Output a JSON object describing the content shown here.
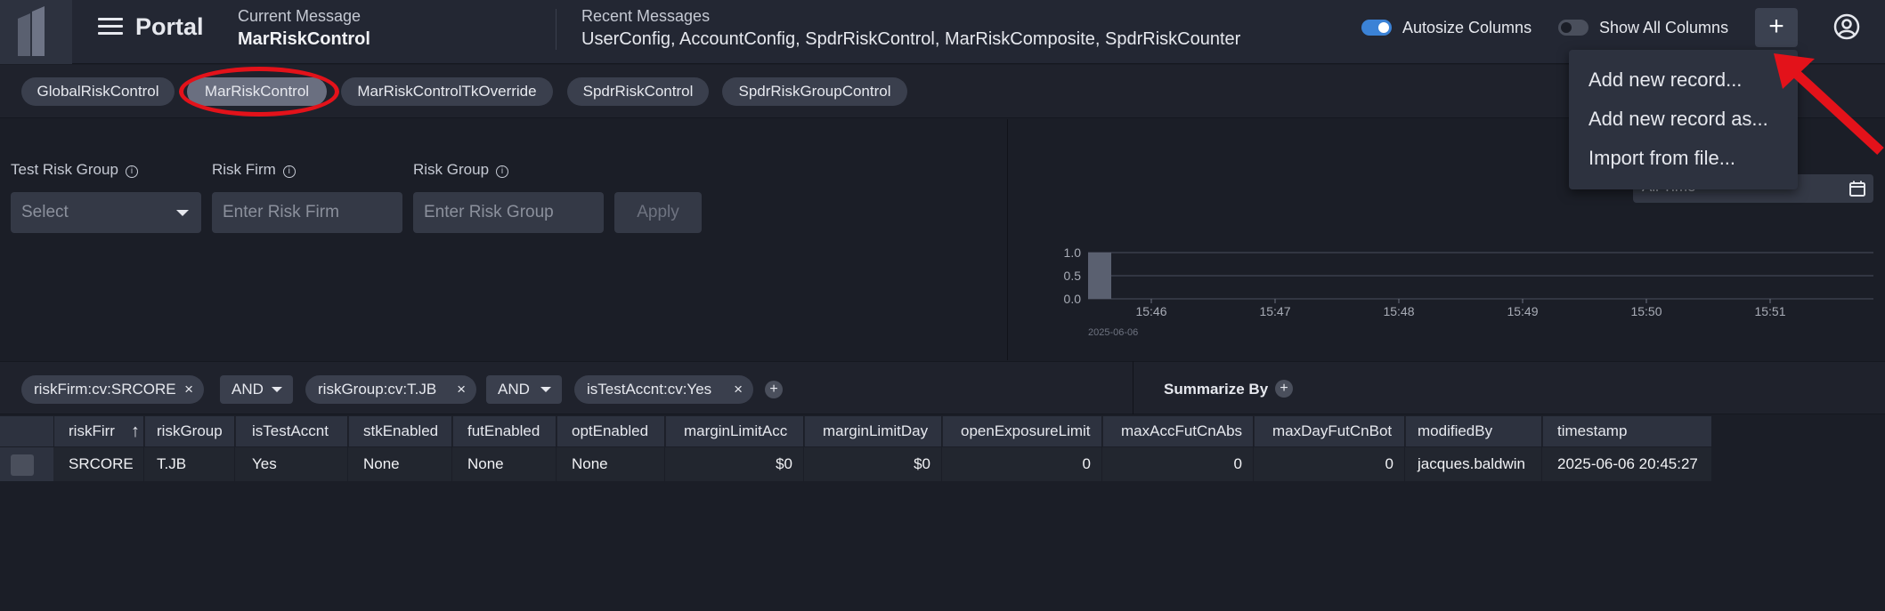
{
  "header": {
    "title": "Portal",
    "current_message_label": "Current Message",
    "current_message": "MarRiskControl",
    "recent_label": "Recent Messages",
    "recent_value": "UserConfig, AccountConfig, SpdrRiskControl, MarRiskComposite, SpdrRiskCounter",
    "autosize_label": "Autosize Columns",
    "autosize_on": true,
    "show_all_label": "Show All Columns",
    "show_all_on": false,
    "plus_label": "+"
  },
  "tabs": [
    {
      "label": "GlobalRiskControl",
      "active": false
    },
    {
      "label": "MarRiskControl",
      "active": true
    },
    {
      "label": "MarRiskControlTkOverride",
      "active": false
    },
    {
      "label": "SpdrRiskControl",
      "active": false
    },
    {
      "label": "SpdrRiskGroupControl",
      "active": false
    }
  ],
  "filters": {
    "test_risk_group_label": "Test Risk Group",
    "test_risk_group_value": "Select",
    "risk_firm_label": "Risk Firm",
    "risk_firm_placeholder": "Enter Risk Firm",
    "risk_group_label": "Risk Group",
    "risk_group_placeholder": "Enter Risk Group",
    "apply_label": "Apply",
    "info_glyph": "i"
  },
  "dropdown": {
    "items": [
      "Add new record...",
      "Add new record as...",
      "Import from file..."
    ]
  },
  "time_range": "All Time",
  "chart_data": {
    "type": "bar",
    "x": [
      "15:45"
    ],
    "values": [
      1.0
    ],
    "x_ticks": [
      "15:46",
      "15:47",
      "15:48",
      "15:49",
      "15:50",
      "15:51"
    ],
    "y_ticks": [
      "1.0",
      "0.5",
      "0.0"
    ],
    "date_label": "2025-06-06",
    "ylim": [
      0,
      1
    ],
    "bar_color": "#5a6070"
  },
  "chips": {
    "filters": [
      "riskFirm:cv:SRCORE",
      "riskGroup:cv:T.JB",
      "isTestAccnt:cv:Yes"
    ],
    "operators": [
      "AND",
      "AND"
    ],
    "close_glyph": "×",
    "add_glyph": "+",
    "summarize_label": "Summarize By"
  },
  "grid": {
    "columns": [
      "riskFirr",
      "riskGroup",
      "isTestAccnt",
      "stkEnabled",
      "futEnabled",
      "optEnabled",
      "marginLimitAcc",
      "marginLimitDay",
      "openExposureLimit",
      "maxAccFutCnAbs",
      "maxDayFutCnBot",
      "modifiedBy",
      "timestamp"
    ],
    "sort_glyph": "↑",
    "rows": [
      [
        "SRCORE",
        "T.JB",
        "Yes",
        "None",
        "None",
        "None",
        "$0",
        "$0",
        "0",
        "0",
        "0",
        "jacques.baldwin",
        "2025-06-06 20:45:27"
      ]
    ]
  },
  "colors": {
    "accent": "#3b82d6",
    "annotation_red": "#e3121a"
  }
}
